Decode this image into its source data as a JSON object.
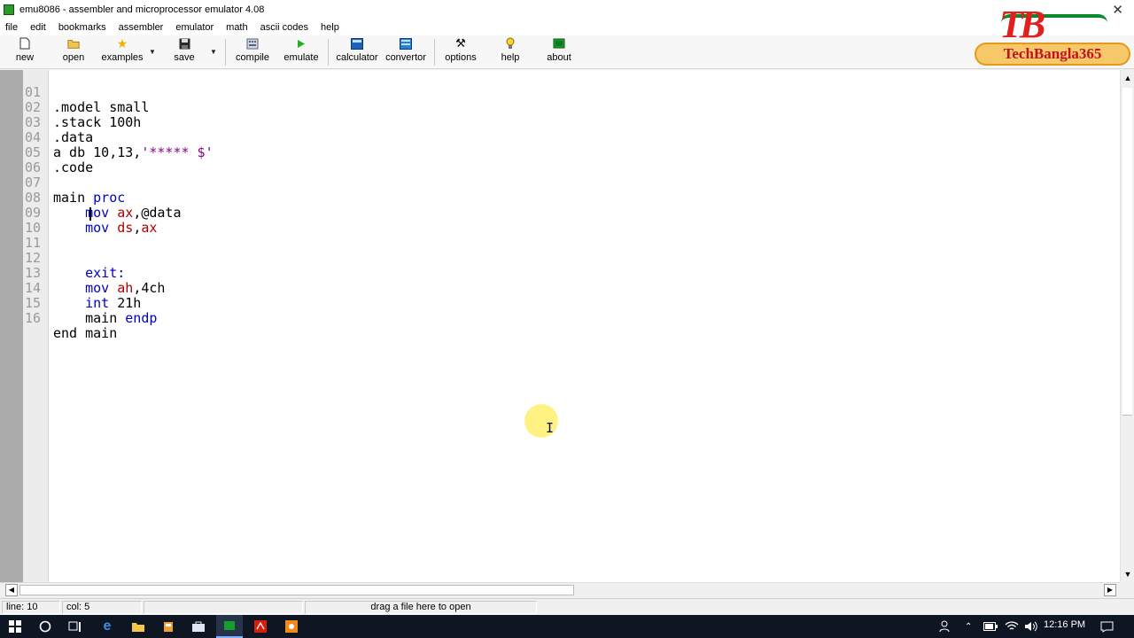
{
  "window": {
    "title": "emu8086 - assembler and microprocessor emulator 4.08",
    "close_glyph": "✕"
  },
  "menu": [
    "file",
    "edit",
    "bookmarks",
    "assembler",
    "emulator",
    "math",
    "ascii codes",
    "help"
  ],
  "toolbar": {
    "new": "new",
    "open": "open",
    "examples": "examples",
    "save": "save",
    "compile": "compile",
    "emulate": "emulate",
    "calculator": "calculator",
    "convertor": "convertor",
    "options": "options",
    "help": "help",
    "about": "about"
  },
  "watermark": {
    "letters": "TB",
    "text": "TechBangla365"
  },
  "editor": {
    "line_numbers": [
      "01",
      "02",
      "03",
      "04",
      "05",
      "06",
      "07",
      "08",
      "09",
      "10",
      "11",
      "12",
      "13",
      "14",
      "15",
      "16"
    ],
    "lines": {
      "l1": ".model small",
      "l2": ".stack 100h",
      "l3": ".data",
      "l4a": "a db 10,13,",
      "l4b": "'***** $'",
      "l5": ".code",
      "l7a": "main ",
      "l7b": "proc",
      "l8a": "    mov ",
      "l8b": "ax",
      "l8c": ",@data",
      "l9a": "    mov ",
      "l9b": "ds",
      "l9c": ",",
      "l9d": "ax",
      "l12": "    exit:",
      "l13a": "    mov ",
      "l13b": "ah",
      "l13c": ",4ch",
      "l14a": "    int ",
      "l14b": "21h",
      "l15a": "    main ",
      "l15b": "endp",
      "l16": "end main"
    },
    "colors": {
      "keyword": "#0000c8",
      "register": "#b00000",
      "string": "#8b008b"
    }
  },
  "status": {
    "line": "line: 10",
    "col": "col: 5",
    "hint": "drag a file here to open"
  },
  "taskbar": {
    "time": "12:16 PM"
  }
}
